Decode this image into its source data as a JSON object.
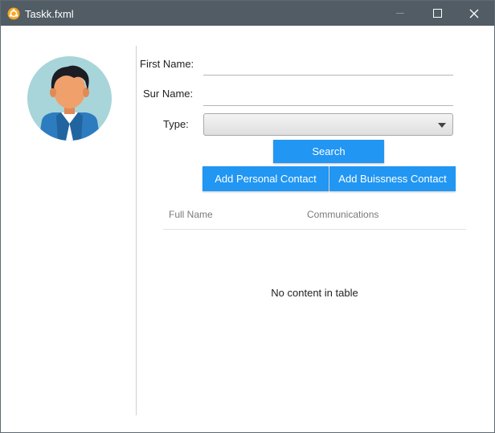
{
  "window": {
    "title": "Taskk.fxml",
    "icon": "app-logo-icon",
    "controls": [
      "minimize-icon",
      "maximize-icon",
      "close-icon"
    ]
  },
  "avatar": {
    "icon": "user-avatar-icon"
  },
  "form": {
    "first_name": {
      "label": "First Name:",
      "value": "",
      "placeholder": ""
    },
    "sur_name": {
      "label": "Sur Name:",
      "value": "",
      "placeholder": ""
    },
    "type": {
      "label": "Type:",
      "selected": ""
    }
  },
  "buttons": {
    "search": "Search",
    "add_personal": "Add Personal Contact",
    "add_business": "Add Buissness Contact"
  },
  "table": {
    "columns": [
      "Full Name",
      "Communications"
    ],
    "rows": [],
    "placeholder": "No content in table"
  },
  "colors": {
    "titlebar": "#515c64",
    "accent": "#2196f3",
    "avatar_bg": "#a8d5d9"
  }
}
